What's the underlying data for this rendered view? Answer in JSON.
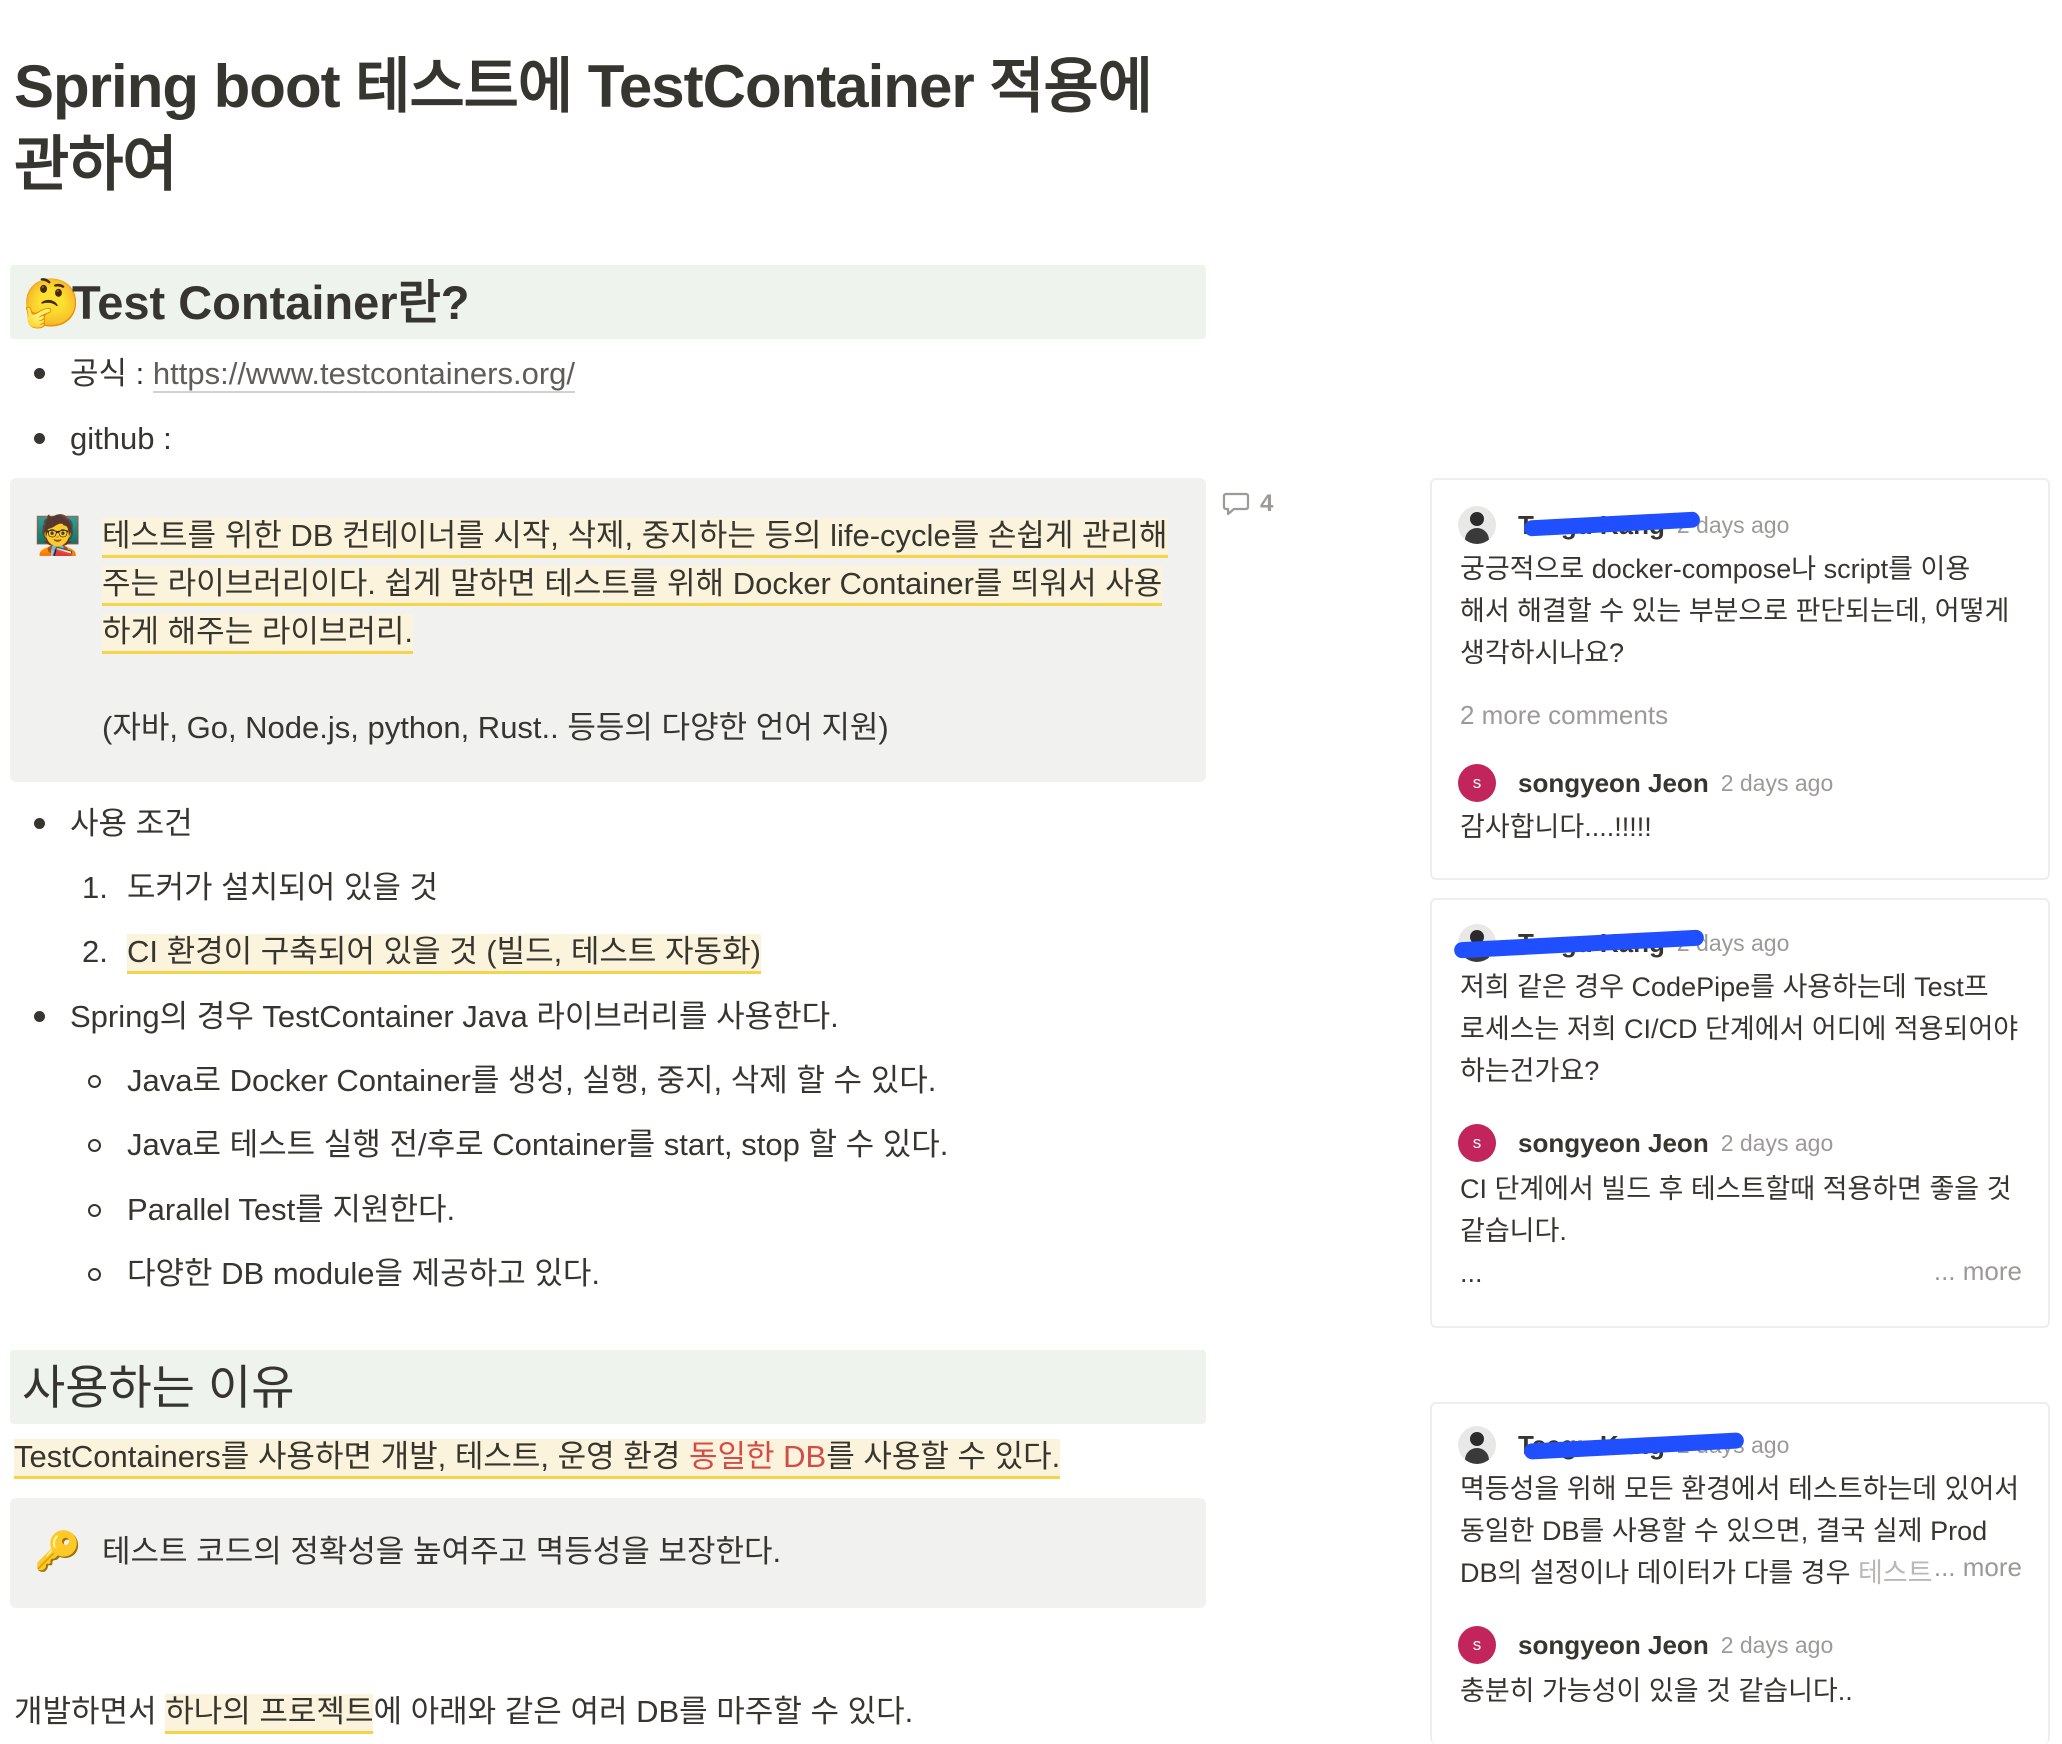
{
  "page": {
    "title": "Spring boot 테스트에 TestContainer 적용에 관하여"
  },
  "section1": {
    "emoji": "🤔",
    "heading": "Test Container란?",
    "official_label": "공식 : ",
    "official_url": "https://www.testcontainers.org/",
    "github_label": "github :"
  },
  "callout1": {
    "icon": "🧑‍🏫",
    "line1": "테스트를 위한 DB 컨테이너를 시작, 삭제, 중지하는 등의 life-cycle를 손쉽게 관리해",
    "line2": "주는 라이브러리이다. 쉽게 말하면 테스트를 위해 Docker Container를 띄워서 사용",
    "line3": "하게 해주는 라이브러리.",
    "line4": "(자바, Go, Node.js, python, Rust.. 등등의 다양한 언어 지원)"
  },
  "comment_count": "4",
  "usage": {
    "label": "사용 조건",
    "items": [
      {
        "num": "1.",
        "text": "도커가 설치되어 있을 것"
      },
      {
        "num": "2.",
        "text": "CI 환경이 구축되어 있을 것 (빌드, 테스트 자동화)"
      }
    ]
  },
  "spring": {
    "label": "Spring의 경우 TestContainer Java 라이브러리를 사용한다.",
    "items": [
      "Java로 Docker Container를 생성, 실행, 중지, 삭제 할 수 있다.",
      "Java로 테스트 실행 전/후로 Container를 start, stop 할 수 있다.",
      "Parallel Test를 지원한다.",
      "다양한 DB module을 제공하고 있다."
    ]
  },
  "section2": {
    "heading": "사용하는 이유",
    "line_before": "TestContainers를 사용하면 개발, 테스트, 운영 환경 ",
    "line_red": "동일한 DB",
    "line_after": "를 사용할 수 있다. ",
    "callout_icon": "🔑",
    "callout_text": "테스트 코드의 정확성을 높여주고 멱등성을 보장한다.",
    "bottom_before": "개발하면서 ",
    "bottom_hl": "하나의 프로젝트",
    "bottom_after": "에 아래와 같은 여러 DB를 마주할 수 있다."
  },
  "threads": [
    {
      "first": {
        "author": "Taegu Kang",
        "time": "2 days ago",
        "lines": [
          "궁긍적으로 docker-compose나 script를 이용",
          "해서 해결할 수 있는 부분으로 판단되는데, 어떻게",
          "생각하시나요?"
        ]
      },
      "more_comments": "2 more comments",
      "reply": {
        "avatar": "s",
        "author": "songyeon Jeon",
        "time": "2 days ago",
        "lines": [
          "감사합니다....!!!!!"
        ]
      }
    },
    {
      "first": {
        "author": "Taegu Kang",
        "time": "2 days ago",
        "lines": [
          "저희 같은 경우 CodePipe를 사용하는데 Test프",
          "로세스는 저희 CI/CD 단계에서 어디에 적용되어야",
          "하는건가요?"
        ]
      },
      "reply": {
        "avatar": "s",
        "author": "songyeon Jeon",
        "time": "2 days ago",
        "lines": [
          "CI 단계에서 빌드 후 테스트할때 적용하면 좋을 것",
          "같습니다.",
          "..."
        ]
      },
      "more": "... more"
    },
    {
      "first": {
        "author": "Taegu Kang",
        "time": "2 days ago",
        "lines": [
          "멱등성을 위해 모든 환경에서 테스트하는데 있어서",
          "동일한 DB를 사용할 수 있으면, 결국 실제 Prod",
          "DB의 설정이나 데이터가 다를 경우 "
        ],
        "fade_tail": "테스트"
      },
      "more": "... more",
      "reply": {
        "avatar": "s",
        "author": "songyeon Jeon",
        "time": "2 days ago",
        "lines": [
          "충분히 가능성이 있을 것 같습니다.."
        ]
      }
    }
  ]
}
